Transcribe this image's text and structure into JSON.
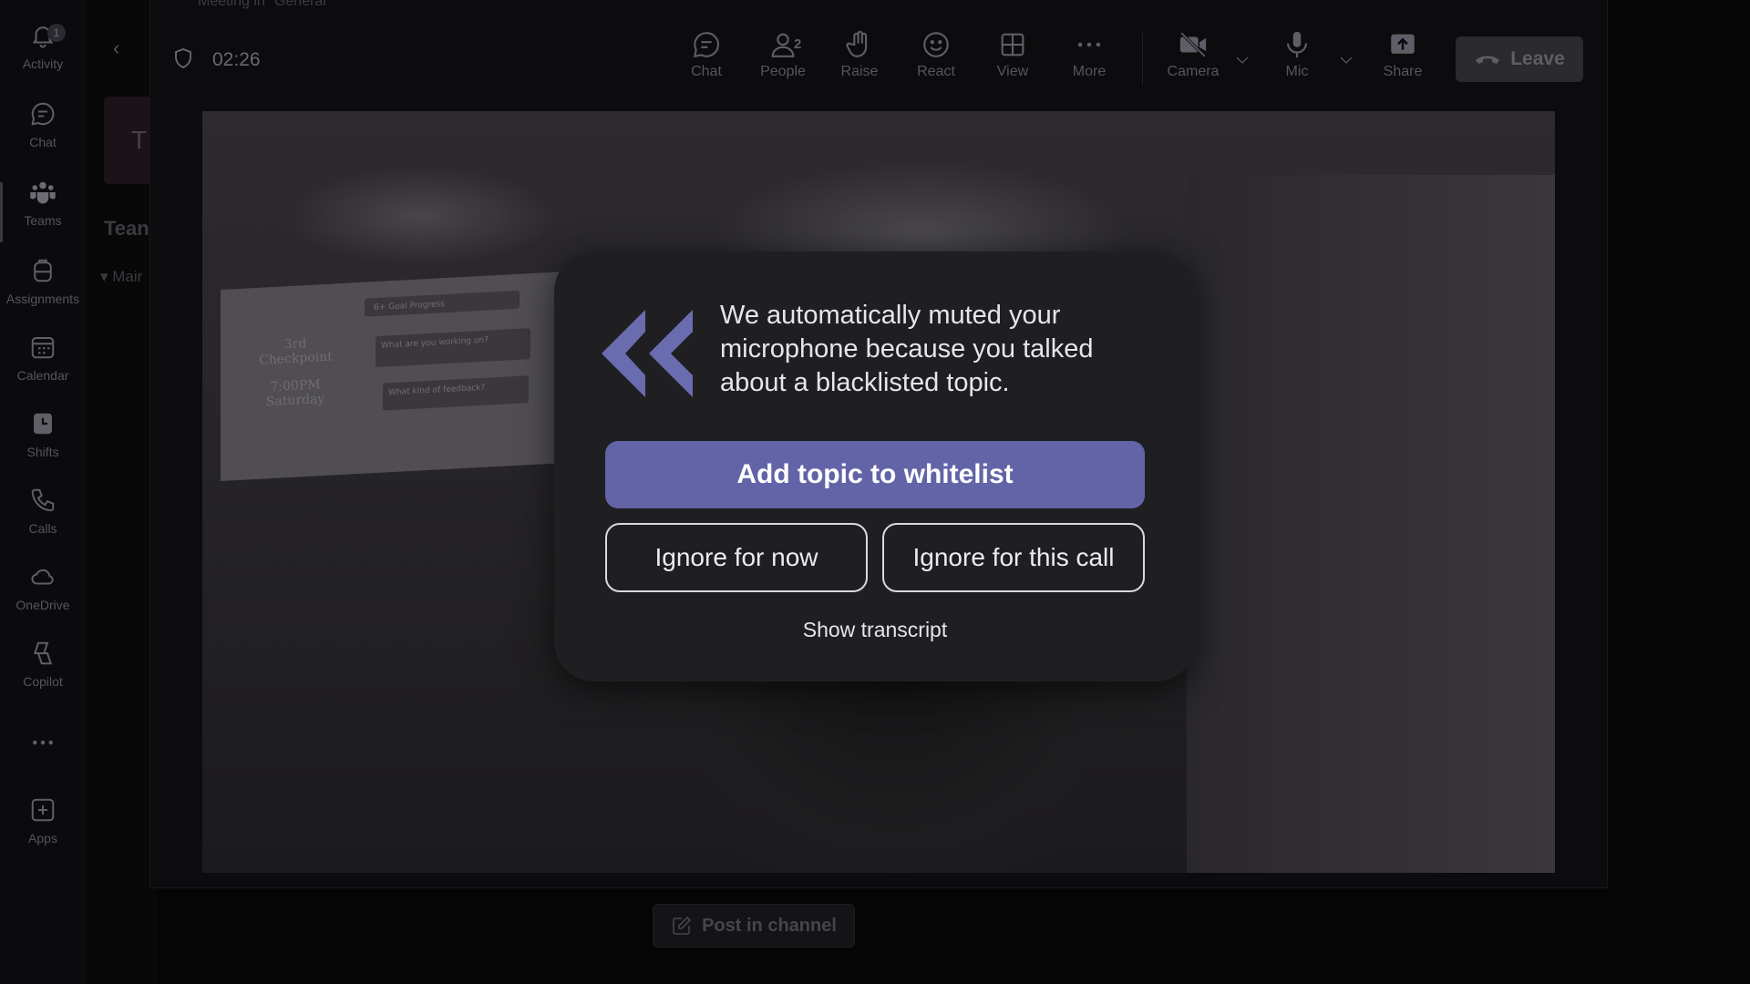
{
  "window": {
    "title": "Meeting in \"General\""
  },
  "rail": {
    "items": [
      {
        "label": "Activity",
        "icon": "bell-icon",
        "badge": "1"
      },
      {
        "label": "Chat",
        "icon": "chat-icon"
      },
      {
        "label": "Teams",
        "icon": "teams-icon",
        "active": true
      },
      {
        "label": "Assignments",
        "icon": "backpack-icon"
      },
      {
        "label": "Calendar",
        "icon": "calendar-icon"
      },
      {
        "label": "Shifts",
        "icon": "shifts-icon"
      },
      {
        "label": "Calls",
        "icon": "phone-icon"
      },
      {
        "label": "OneDrive",
        "icon": "cloud-icon"
      },
      {
        "label": "Copilot",
        "icon": "copilot-icon"
      },
      {
        "label": "Apps",
        "icon": "plus-square-icon"
      }
    ]
  },
  "team_panel": {
    "tile_letter": "T",
    "heading": "Tean",
    "channel": "Mair"
  },
  "meeting": {
    "timer": "02:26",
    "toolbar": {
      "chat": "Chat",
      "people": "People",
      "people_count": "2",
      "raise": "Raise",
      "react": "React",
      "view": "View",
      "more": "More",
      "camera": "Camera",
      "mic": "Mic",
      "share": "Share",
      "leave": "Leave"
    },
    "post_in_channel": "Post in channel"
  },
  "video": {
    "board_lines": [
      "3rd",
      "Checkpoint",
      "7:00PM",
      "Saturday"
    ],
    "note_texts": [
      "6+ Goal Progress",
      "What are you working on?",
      "What kind of feedback?"
    ]
  },
  "modal": {
    "message": "We automatically muted your microphone because you talked about a blacklisted topic.",
    "primary_button": "Add topic to whitelist",
    "ignore_now": "Ignore for now",
    "ignore_call": "Ignore for this call",
    "show_transcript": "Show transcript",
    "accent_color": "#6264a7"
  }
}
